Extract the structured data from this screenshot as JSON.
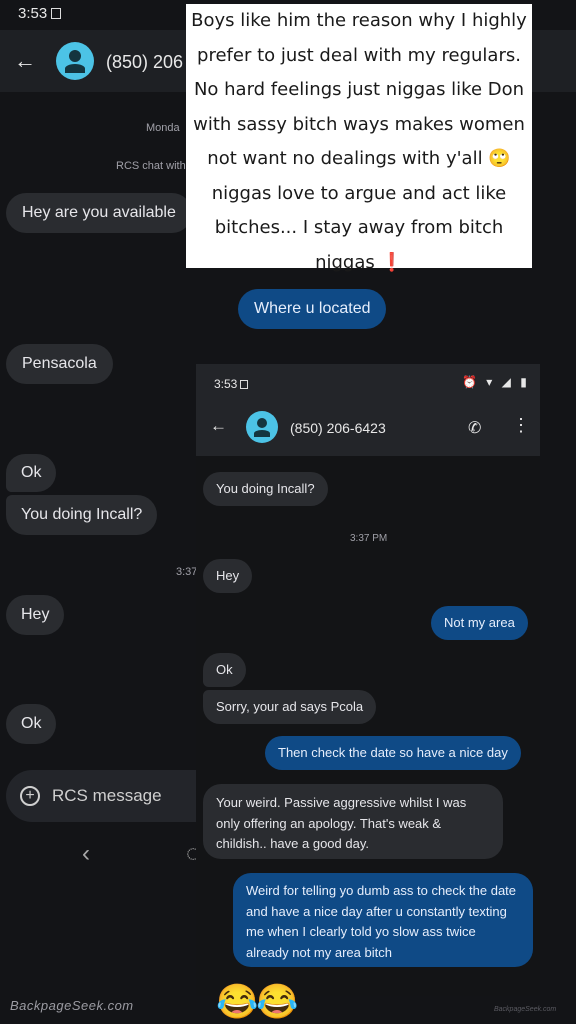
{
  "background": {
    "status_time": "3:53",
    "contact_name": "(850) 206",
    "date_label": "Monda",
    "rcs_label": "RCS chat with",
    "time_label": "3:37",
    "composer_placeholder": "RCS message",
    "messages": [
      {
        "dir": "in",
        "text": "Hey are you available"
      },
      {
        "dir": "out",
        "text": "Where u located"
      },
      {
        "dir": "in",
        "text": "Pensacola"
      },
      {
        "dir": "in",
        "text": "Ok"
      },
      {
        "dir": "in",
        "text": "You doing Incall?"
      },
      {
        "dir": "in",
        "text": "Hey"
      },
      {
        "dir": "in",
        "text": "Ok"
      }
    ]
  },
  "caption": {
    "lines": [
      "Boys like him the reason why I highly",
      "prefer to just deal with my regulars.",
      "No hard feelings just niggas like Don",
      "with sassy bitch ways makes women",
      "not want no dealings with y'all 🙄",
      "niggas love to argue and act like",
      "bitches... I stay away from bitch",
      "niggas ❗"
    ]
  },
  "overlay": {
    "status_time": "3:53",
    "status_icons": "⏰ ▾ ◢ ▮",
    "contact_name": "(850) 206-6423",
    "time_label": "3:37 PM",
    "messages": [
      {
        "dir": "in",
        "text": "You doing Incall?"
      },
      {
        "dir": "in",
        "text": "Hey"
      },
      {
        "dir": "out",
        "text": "Not my area"
      },
      {
        "dir": "in",
        "text": "Ok"
      },
      {
        "dir": "in",
        "text": "Sorry, your ad says Pcola"
      },
      {
        "dir": "out",
        "text": "Then check the date so have a nice day"
      },
      {
        "dir": "in",
        "text": "Your weird. Passive aggressive whilst I was only offering an apology. That's weak & childish.. have a good day."
      },
      {
        "dir": "out",
        "text": "Weird for telling yo dumb ass to check the date and have a nice day after u constantly texting me when I clearly told yo slow ass twice already not my area bitch"
      }
    ]
  },
  "emojis": "😂😂",
  "watermark": "BackpageSeek.com",
  "watermark_small": "BackpageSeek.com"
}
